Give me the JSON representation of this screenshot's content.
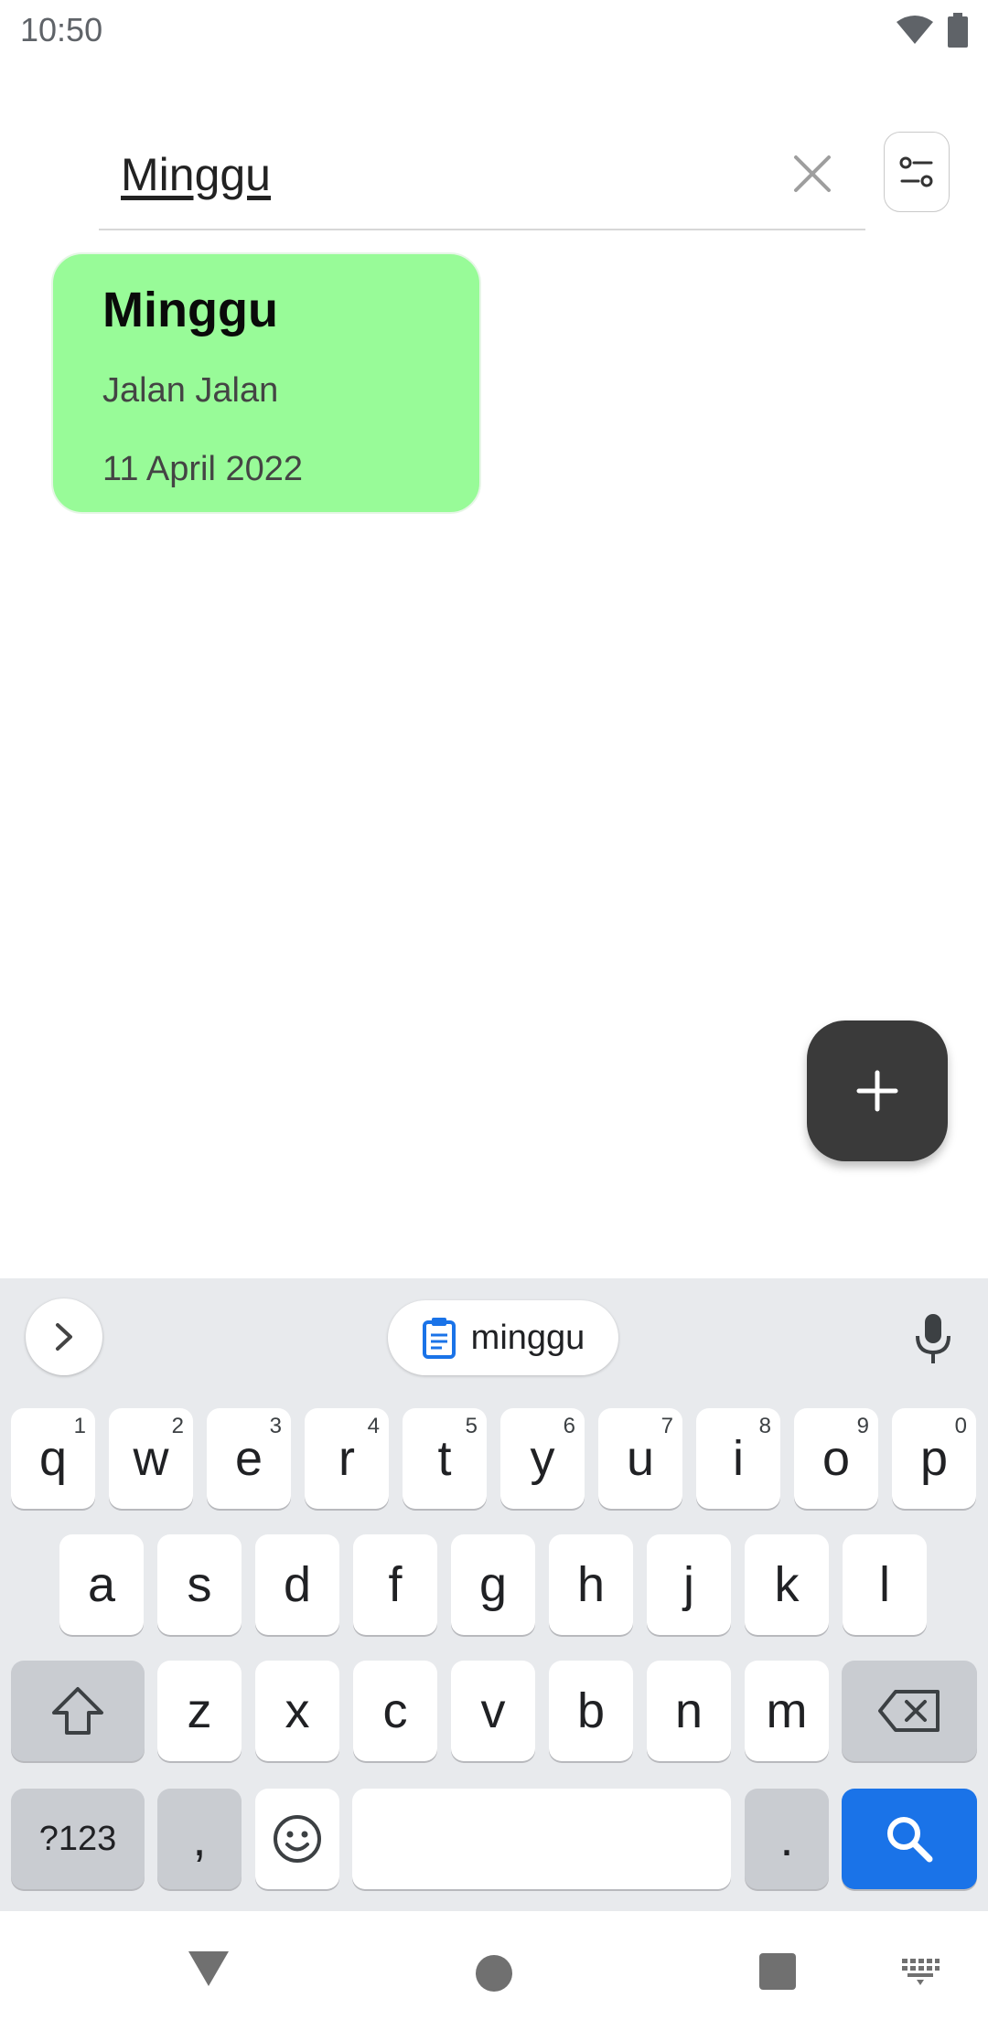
{
  "status_bar": {
    "time": "10:50",
    "icons": [
      "wifi-icon",
      "battery-icon"
    ]
  },
  "search": {
    "query": "Minggu",
    "clear_icon": "close-icon",
    "filter_icon": "filter-icon"
  },
  "notes": [
    {
      "title": "Minggu",
      "body": "Jalan Jalan",
      "date": "11 April 2022",
      "color": "#98FB98"
    }
  ],
  "fab": {
    "icon": "plus-icon"
  },
  "keyboard": {
    "suggestion": "minggu",
    "row1": [
      {
        "k": "q",
        "h": "1"
      },
      {
        "k": "w",
        "h": "2"
      },
      {
        "k": "e",
        "h": "3"
      },
      {
        "k": "r",
        "h": "4"
      },
      {
        "k": "t",
        "h": "5"
      },
      {
        "k": "y",
        "h": "6"
      },
      {
        "k": "u",
        "h": "7"
      },
      {
        "k": "i",
        "h": "8"
      },
      {
        "k": "o",
        "h": "9"
      },
      {
        "k": "p",
        "h": "0"
      }
    ],
    "row2": [
      "a",
      "s",
      "d",
      "f",
      "g",
      "h",
      "j",
      "k",
      "l"
    ],
    "row3": [
      "z",
      "x",
      "c",
      "v",
      "b",
      "n",
      "m"
    ],
    "symbols_label": "?123",
    "comma_label": ",",
    "period_label": ".",
    "accent_color": "#1A73E8"
  },
  "nav": {
    "icons": [
      "back-icon",
      "home-icon",
      "recents-icon",
      "keyboard-switch-icon"
    ]
  }
}
